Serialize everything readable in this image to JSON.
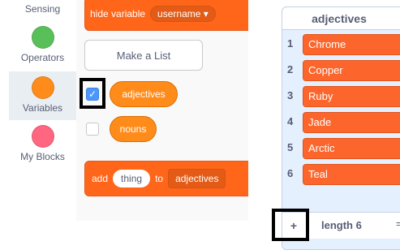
{
  "categories": [
    {
      "label": "Sensing",
      "color": "#5cb1d6"
    },
    {
      "label": "Operators",
      "color": "#59c059"
    },
    {
      "label": "Variables",
      "color": "#ff8c1a",
      "active": true
    },
    {
      "label": "My Blocks",
      "color": "#ff6680"
    }
  ],
  "palette": {
    "hide_variable_label": "hide variable",
    "hide_variable_dropdown": "username ▾",
    "make_list_label": "Make a List",
    "list_reporters": [
      {
        "label": "adjectives",
        "checked": true
      },
      {
        "label": "nouns",
        "checked": false
      }
    ],
    "add_block": {
      "add_label": "add",
      "item_value": "thing",
      "to_label": "to",
      "list_dropdown": "adjectives"
    }
  },
  "monitor": {
    "title": "adjectives",
    "items": [
      {
        "index": "1",
        "value": "Chrome"
      },
      {
        "index": "2",
        "value": "Copper"
      },
      {
        "index": "3",
        "value": "Ruby"
      },
      {
        "index": "4",
        "value": "Jade"
      },
      {
        "index": "5",
        "value": "Arctic"
      },
      {
        "index": "6",
        "value": "Teal"
      }
    ],
    "add_item_label": "+",
    "length_label": "length 6",
    "resize_label": "="
  },
  "colors": {
    "list_block": "#ff661a",
    "list_item": "#fc662c",
    "monitor_bg": "#e5f0ff",
    "checkbox_checked": "#4c97ff"
  }
}
